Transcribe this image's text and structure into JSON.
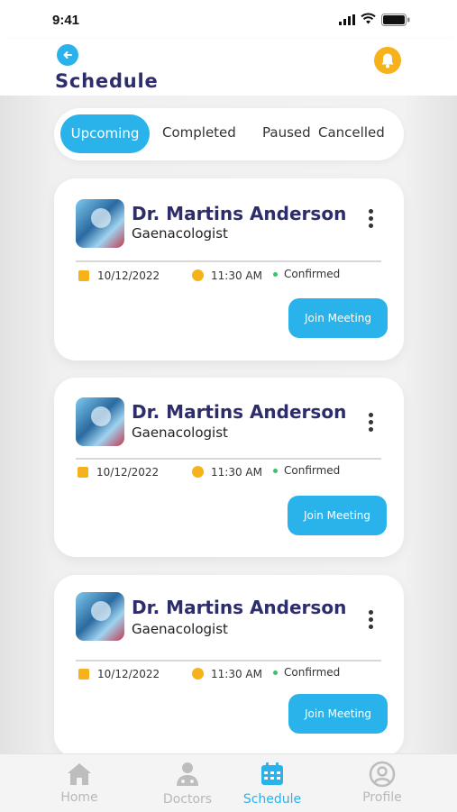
{
  "status_bar": {
    "time": "9:41"
  },
  "header": {
    "title": "Schedule"
  },
  "tabs": [
    {
      "label": "Upcoming",
      "active": true
    },
    {
      "label": "Completed",
      "active": false
    },
    {
      "label": "Paused",
      "active": false
    },
    {
      "label": "Cancelled",
      "active": false
    }
  ],
  "appointments": [
    {
      "doctor": "Dr. Martins Anderson",
      "specialty": "Gaenacologist",
      "date": "10/12/2022",
      "time": "11:30 AM",
      "status": "Confirmed",
      "action": "Join Meeting"
    },
    {
      "doctor": "Dr. Martins Anderson",
      "specialty": "Gaenacologist",
      "date": "10/12/2022",
      "time": "11:30 AM",
      "status": "Confirmed",
      "action": "Join Meeting"
    },
    {
      "doctor": "Dr. Martins Anderson",
      "specialty": "Gaenacologist",
      "date": "10/12/2022",
      "time": "11:30 AM",
      "status": "Confirmed",
      "action": "Join Meeting"
    }
  ],
  "nav": [
    {
      "label": "Home",
      "icon": "home-icon",
      "active": false
    },
    {
      "label": "Doctors",
      "icon": "doctor-icon",
      "active": false
    },
    {
      "label": "Schedule",
      "icon": "calendar-icon",
      "active": true
    },
    {
      "label": "Profile",
      "icon": "profile-icon",
      "active": false
    }
  ],
  "colors": {
    "accent": "#2ab3ea",
    "title": "#2e2d6b",
    "warning": "#f6b21b",
    "confirmed": "#39c46a"
  }
}
